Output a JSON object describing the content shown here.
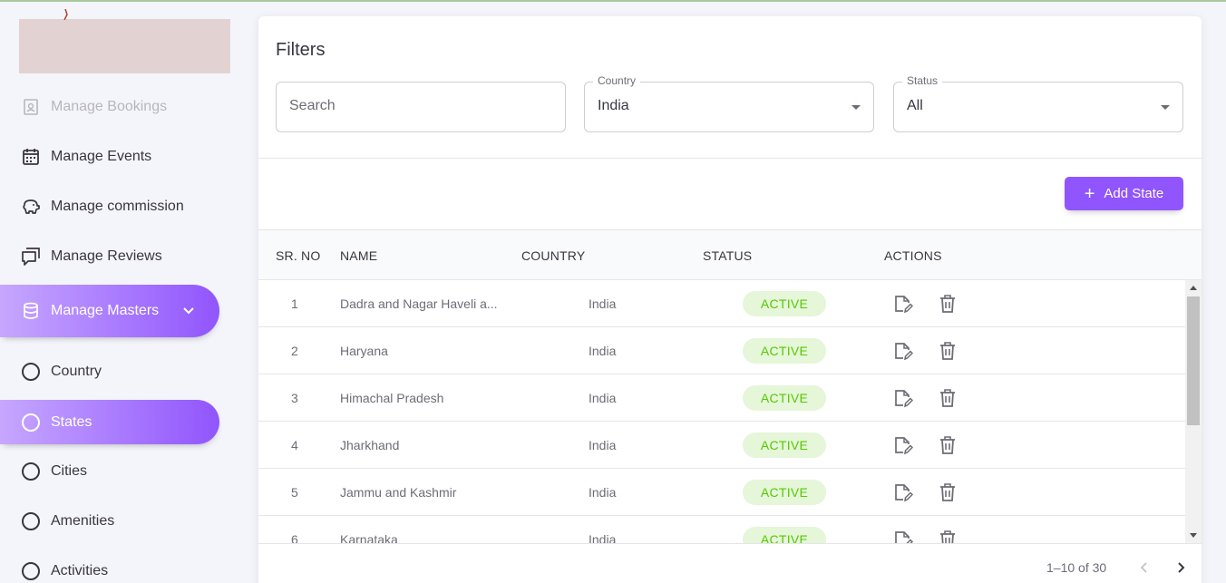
{
  "sidebar": {
    "items": [
      {
        "label": "Manage Bookings",
        "icon": "bookings-icon"
      },
      {
        "label": "Manage Events",
        "icon": "calendar-icon"
      },
      {
        "label": "Manage commission",
        "icon": "piggy-bank-icon"
      },
      {
        "label": "Manage Reviews",
        "icon": "reviews-icon"
      },
      {
        "label": "Manage Masters",
        "icon": "database-icon"
      }
    ],
    "sub_items": [
      {
        "label": "Country"
      },
      {
        "label": "States"
      },
      {
        "label": "Cities"
      },
      {
        "label": "Amenities"
      },
      {
        "label": "Activities"
      }
    ],
    "active_item": "Manage Masters",
    "active_sub_item": "States"
  },
  "filters": {
    "title": "Filters",
    "search_placeholder": "Search",
    "country_label": "Country",
    "country_value": "India",
    "status_label": "Status",
    "status_value": "All"
  },
  "add_button": "Add State",
  "table": {
    "headers": [
      "SR. NO",
      "NAME",
      "COUNTRY",
      "STATUS",
      "ACTIONS"
    ],
    "rows": [
      {
        "sr": "1",
        "name": "Dadra and Nagar Haveli a...",
        "country": "India",
        "status": "ACTIVE"
      },
      {
        "sr": "2",
        "name": "Haryana",
        "country": "India",
        "status": "ACTIVE"
      },
      {
        "sr": "3",
        "name": "Himachal Pradesh",
        "country": "India",
        "status": "ACTIVE"
      },
      {
        "sr": "4",
        "name": "Jharkhand",
        "country": "India",
        "status": "ACTIVE"
      },
      {
        "sr": "5",
        "name": "Jammu and Kashmir",
        "country": "India",
        "status": "ACTIVE"
      },
      {
        "sr": "6",
        "name": "Karnataka",
        "country": "India",
        "status": "ACTIVE"
      }
    ]
  },
  "pagination": {
    "text": "1–10 of 30"
  },
  "colors": {
    "accent": "#9155fd",
    "active_badge_bg": "#e5f6d9",
    "active_badge_text": "#56ca00"
  }
}
